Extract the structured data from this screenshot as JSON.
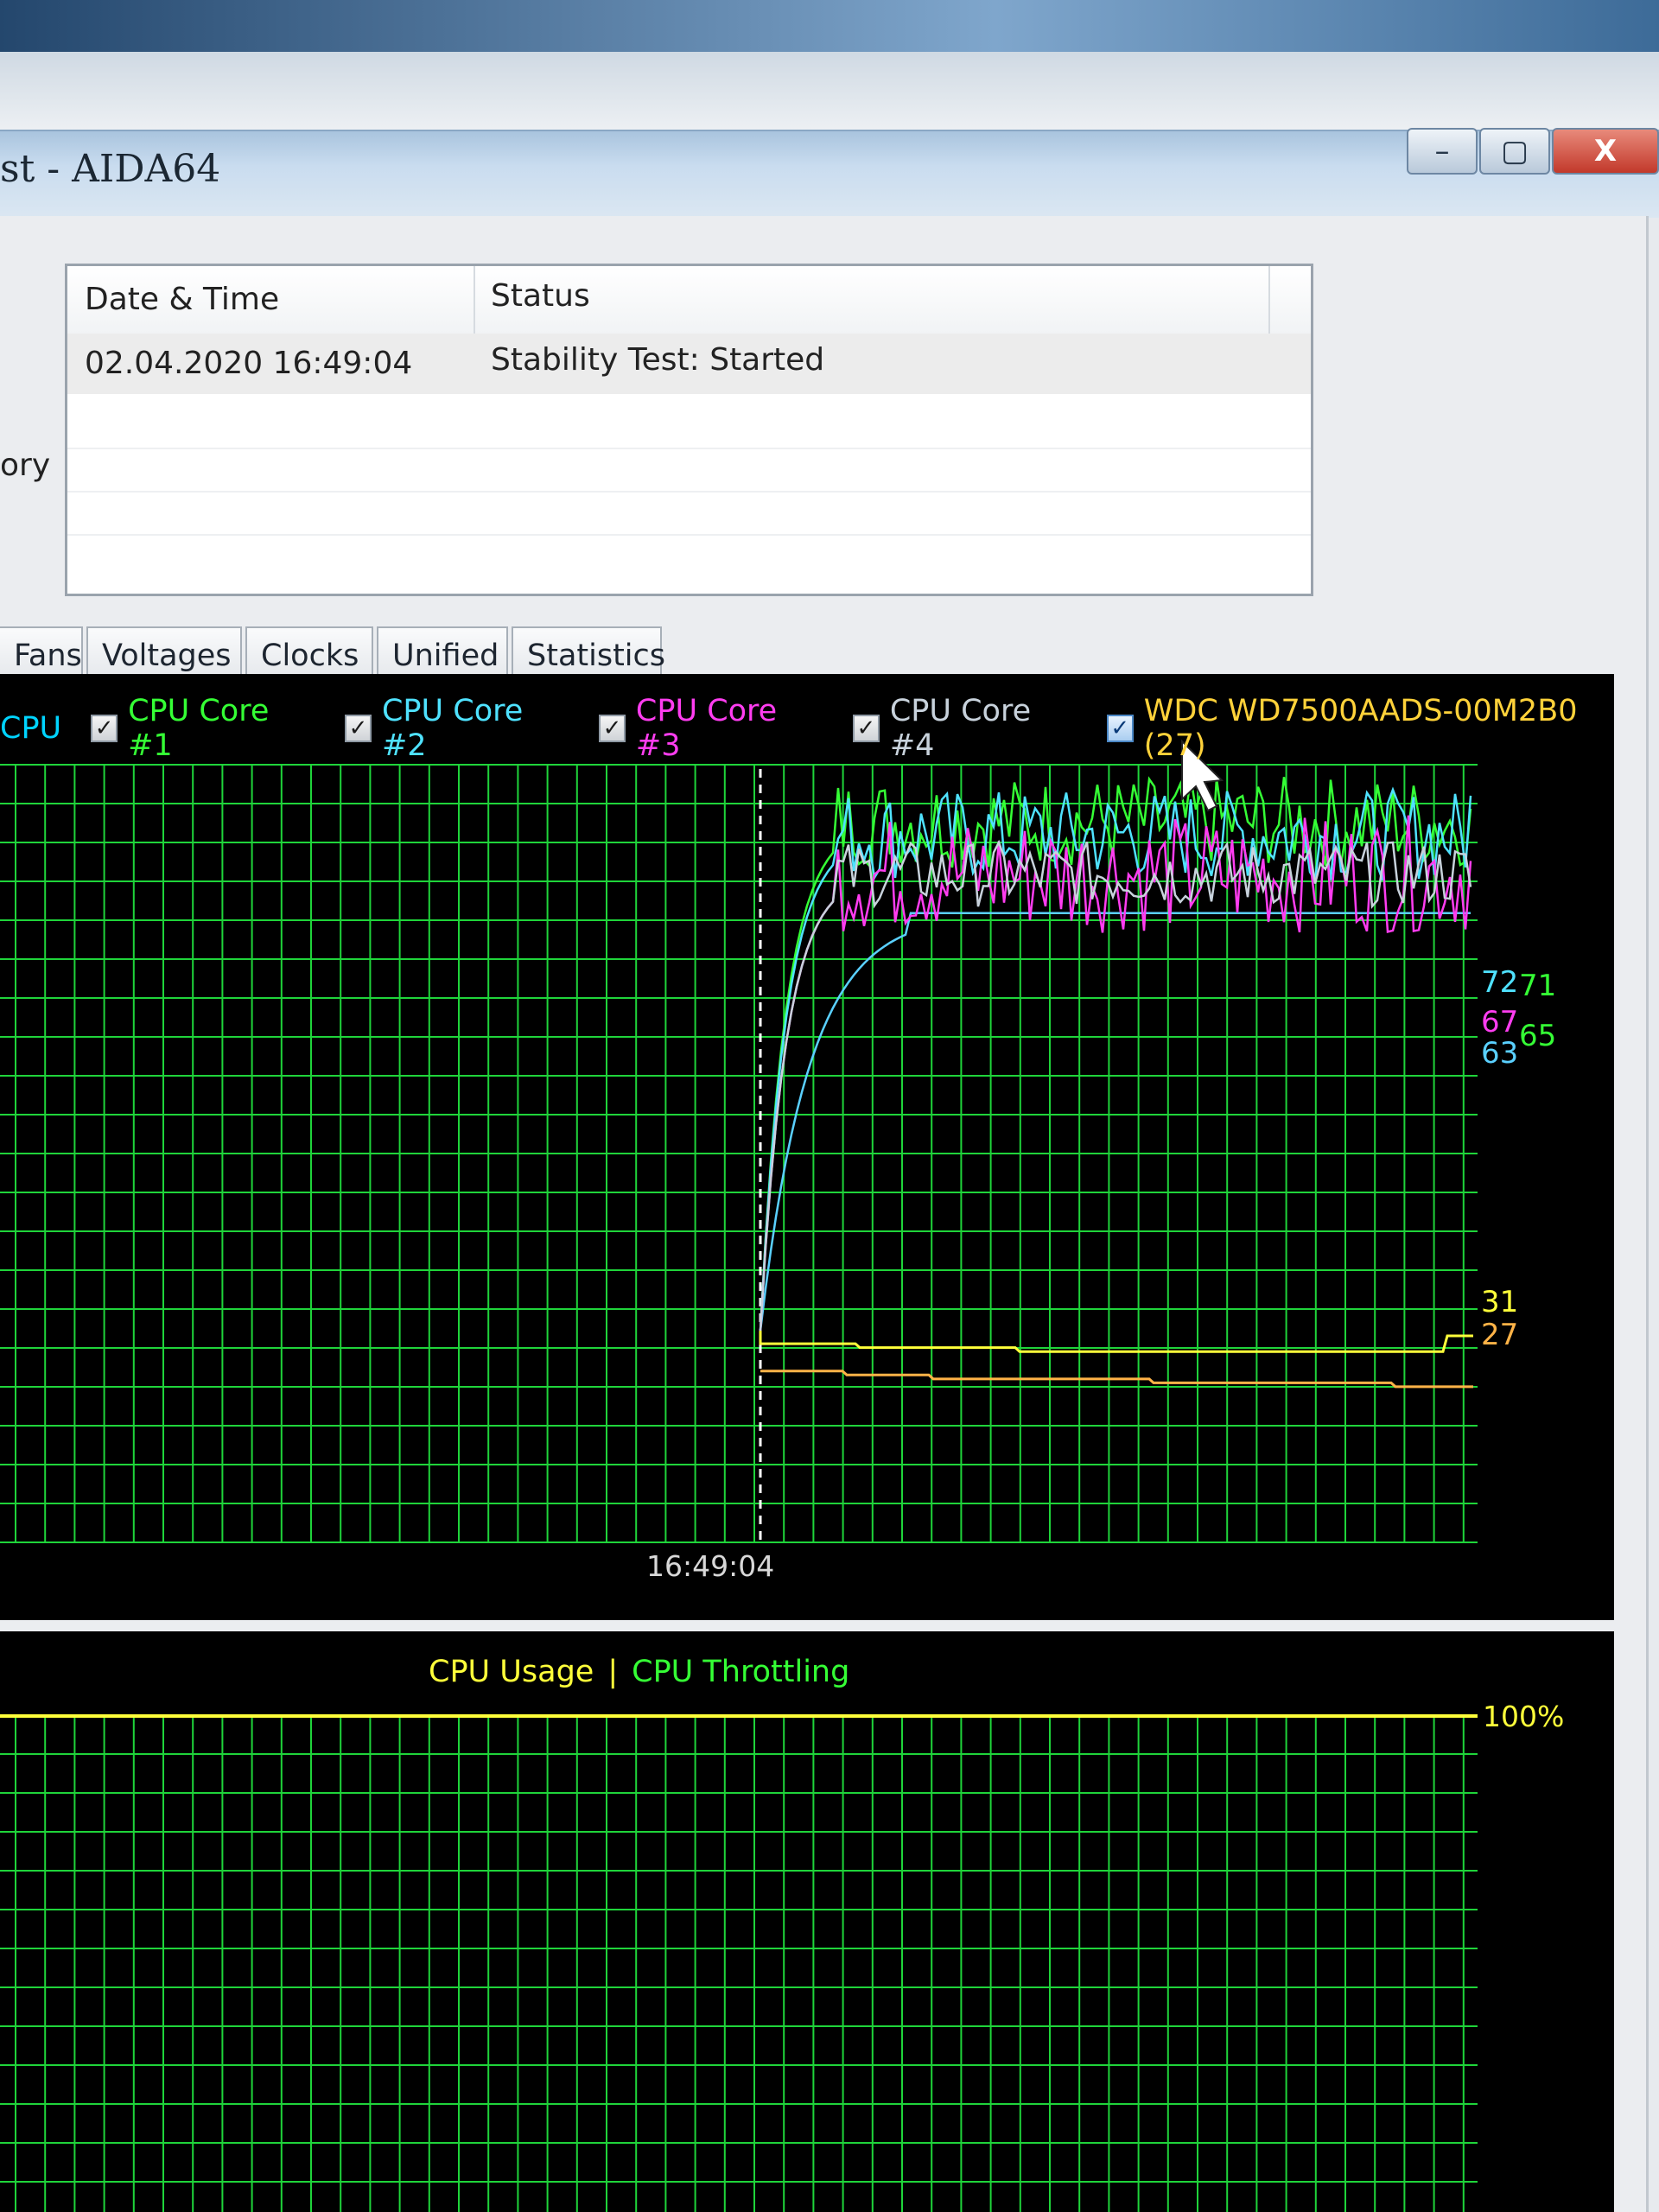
{
  "window": {
    "title": "st - AIDA64",
    "controls": {
      "minimize": "–",
      "maximize": "▢",
      "close": "X"
    }
  },
  "log": {
    "columns": [
      "Date & Time",
      "Status"
    ],
    "rows": [
      {
        "datetime": "02.04.2020 16:49:04",
        "status": "Stability Test: Started"
      }
    ]
  },
  "side_label": "ory",
  "tabs": [
    "Fans",
    "Voltages",
    "Clocks",
    "Unified",
    "Statistics"
  ],
  "temperature_chart": {
    "legend": [
      {
        "label": "CPU",
        "color": "#00d4ff",
        "checkbox": false
      },
      {
        "label": "CPU Core #1",
        "color": "#35ff35",
        "checkbox": true
      },
      {
        "label": "CPU Core #2",
        "color": "#4fe2ff",
        "checkbox": true
      },
      {
        "label": "CPU Core #3",
        "color": "#ff3df0",
        "checkbox": true
      },
      {
        "label": "CPU Core #4",
        "color": "#c8d2dc",
        "checkbox": true
      },
      {
        "label": "WDC WD7500AADS-00M2B0 (27)",
        "color": "#ffd23a",
        "checkbox": true
      }
    ],
    "time_marker": "16:49:04",
    "end_values": [
      "72",
      "71",
      "67",
      "65",
      "63",
      "31",
      "27"
    ]
  },
  "chart_data": {
    "type": "line",
    "xlabel": "",
    "ylabel": "",
    "time_marker": "16:49:04",
    "series": [
      {
        "name": "CPU",
        "color": "#5ad0ff",
        "end_value": 63
      },
      {
        "name": "CPU Core #1",
        "color": "#35ff35",
        "end_value": 71
      },
      {
        "name": "CPU Core #2",
        "color": "#4fe2ff",
        "end_value": 72
      },
      {
        "name": "CPU Core #3",
        "color": "#ff3df0",
        "end_value": 67
      },
      {
        "name": "CPU Core #4",
        "color": "#c8d2dc",
        "end_value": 65
      },
      {
        "name": "WDC WD7500AADS-00M2B0 (27)",
        "color": "#ffb347",
        "end_value": 27
      },
      {
        "color": "#ffff3a",
        "end_value": 31
      }
    ]
  },
  "usage_chart": {
    "legend": [
      {
        "label": "CPU Usage",
        "color": "#ffff3a"
      },
      {
        "label": "|",
        "color": "#ffff3a"
      },
      {
        "label": "CPU Throttling",
        "color": "#35ff35"
      }
    ],
    "label_100": "100%"
  }
}
